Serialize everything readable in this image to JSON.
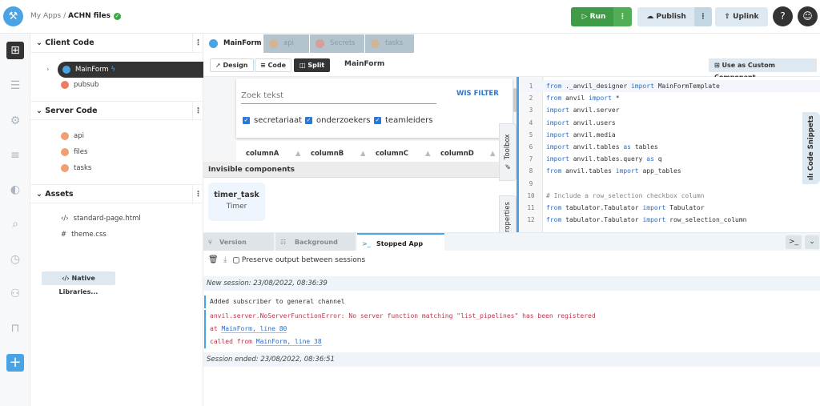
{
  "header": {
    "breadcrumb_parent": "My Apps",
    "breadcrumb_sep": "/",
    "app_name": "ACHN files",
    "run": "Run",
    "publish": "Publish",
    "uplink": "Uplink"
  },
  "tree": {
    "client_code": "Client Code",
    "client_items": [
      "MainForm",
      "pubsub"
    ],
    "server_code": "Server Code",
    "server_items": [
      "api",
      "files",
      "tasks"
    ],
    "assets": "Assets",
    "asset_items": [
      "standard-page.html",
      "theme.css"
    ],
    "native_libraries": "Native Libraries..."
  },
  "tabs": [
    "MainForm",
    "api",
    "Secrets",
    "tasks"
  ],
  "toolbar": {
    "design": "Design",
    "code": "Code",
    "split": "Split",
    "form_name": "MainForm",
    "custom_component": "Use as Custom Component..."
  },
  "designer": {
    "search_placeholder": "Zoek tekst",
    "clear_filter": "WIS FILTER",
    "checkboxes": [
      "secretariaat",
      "onderzoekers",
      "teamleiders"
    ],
    "columns": [
      "columnA",
      "columnB",
      "columnC",
      "columnD"
    ],
    "invisible_header": "Invisible components",
    "component_name": "timer_task",
    "component_type": "Timer",
    "toolbox": "Toolbox",
    "properties": "Properties"
  },
  "code": {
    "snippets": "Code Snippets",
    "lines": [
      "from ._anvil_designer import MainFormTemplate",
      "from anvil import *",
      "import anvil.server",
      "import anvil.users",
      "import anvil.media",
      "import anvil.tables as tables",
      "import anvil.tables.query as q",
      "from anvil.tables import app_tables",
      "",
      "# Include a row_selection checkbox column",
      "from tabulator.Tabulator import Tabulator",
      "from tabulator.Tabulator import row_selection_column"
    ]
  },
  "bottom": {
    "tabs": [
      "Version History",
      "Background Tasks",
      "Stopped App Console"
    ],
    "preserve": "Preserve output between sessions",
    "new_session": "New session: 23/08/2022, 08:36:39",
    "log_info": "Added subscriber to general channel",
    "log_error": "anvil.server.NoServerFunctionError: No server function matching \"list_pipelines\" has been registered",
    "at": "at ",
    "at_link": "MainForm, line 80",
    "called": "called from ",
    "called_link": "MainForm, line 38",
    "session_ended": "Session ended: 23/08/2022, 08:36:51"
  }
}
